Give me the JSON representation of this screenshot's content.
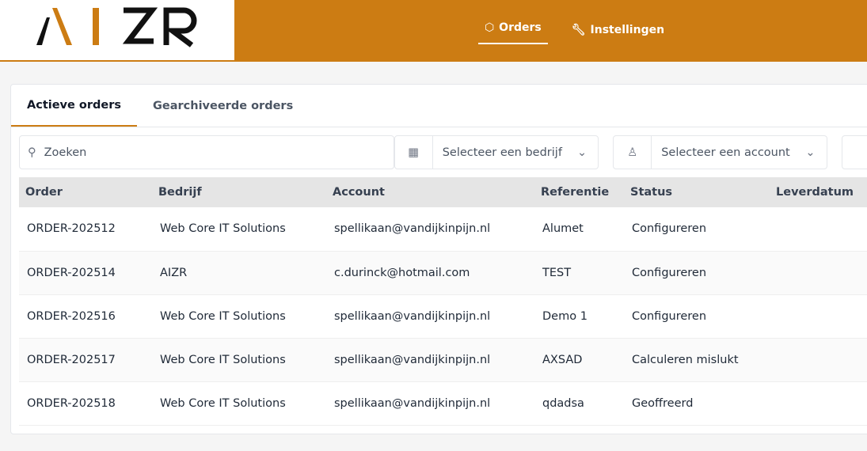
{
  "brand": {
    "logo_text": "AIZR",
    "accent": "#cc7c13"
  },
  "nav": [
    {
      "label": "Orders",
      "icon": "box-icon",
      "active": true
    },
    {
      "label": "Instellingen",
      "icon": "wrench-icon",
      "active": false
    }
  ],
  "tabs": [
    {
      "label": "Actieve orders"
    },
    {
      "label": "Gearchiveerde orders"
    }
  ],
  "filters": {
    "search_placeholder": "Zoeken",
    "company_placeholder": "Selecteer een bedrijf",
    "account_placeholder": "Selecteer een account"
  },
  "table": {
    "headers": [
      "Order",
      "Bedrijf",
      "Account",
      "Referentie",
      "Status",
      "Leverdatum"
    ],
    "rows": [
      [
        "ORDER-202512",
        "Web Core IT Solutions",
        "spellikaan@vandijkinpijn.nl",
        "Alumet",
        "Configureren",
        ""
      ],
      [
        "ORDER-202514",
        "AIZR",
        "c.durinck@hotmail.com",
        "TEST",
        "Configureren",
        ""
      ],
      [
        "ORDER-202516",
        "Web Core IT Solutions",
        "spellikaan@vandijkinpijn.nl",
        "Demo 1",
        "Configureren",
        ""
      ],
      [
        "ORDER-202517",
        "Web Core IT Solutions",
        "spellikaan@vandijkinpijn.nl",
        "AXSAD",
        "Calculeren mislukt",
        ""
      ],
      [
        "ORDER-202518",
        "Web Core IT Solutions",
        "spellikaan@vandijkinpijn.nl",
        "qdadsa",
        "Geoffreerd",
        ""
      ]
    ]
  }
}
